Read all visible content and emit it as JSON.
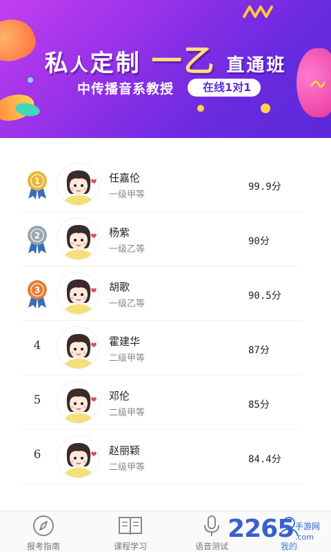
{
  "banner": {
    "title_part1": "私",
    "title_part1b": "人",
    "title_part2": "定制",
    "title_part3": "一乙",
    "title_part4": "直通班",
    "subtitle": "中传播音系教授",
    "badge": "在线1对1"
  },
  "ranking": [
    {
      "rank": "1",
      "medal": "gold",
      "name": "任嘉伦",
      "level": "一级甲等",
      "score": "99.9分"
    },
    {
      "rank": "2",
      "medal": "silver",
      "name": "杨紫",
      "level": "一级乙等",
      "score": "90分"
    },
    {
      "rank": "3",
      "medal": "bronze",
      "name": "胡歌",
      "level": "一级乙等",
      "score": "90.5分"
    },
    {
      "rank": "4",
      "medal": "",
      "name": "霍建华",
      "level": "二级甲等",
      "score": "87分"
    },
    {
      "rank": "5",
      "medal": "",
      "name": "邓伦",
      "level": "二级甲等",
      "score": "85分"
    },
    {
      "rank": "6",
      "medal": "",
      "name": "赵丽颖",
      "level": "二级甲等",
      "score": "84.4分"
    }
  ],
  "tabs": [
    {
      "label": "报考指南",
      "icon": "compass-icon"
    },
    {
      "label": "课程学习",
      "icon": "book-icon"
    },
    {
      "label": "语音测试",
      "icon": "microphone-icon"
    },
    {
      "label": "我的",
      "icon": "profile-icon"
    }
  ],
  "watermark": {
    "big": "2265",
    "small": "手游网",
    "small2": ".com"
  },
  "colors": {
    "banner_start": "#c43ef0",
    "banner_end": "#5a2ad8",
    "gold": "#e9b53a",
    "silver": "#9aa7b0",
    "bronze": "#e0803a",
    "accent": "#3a7bd5"
  }
}
